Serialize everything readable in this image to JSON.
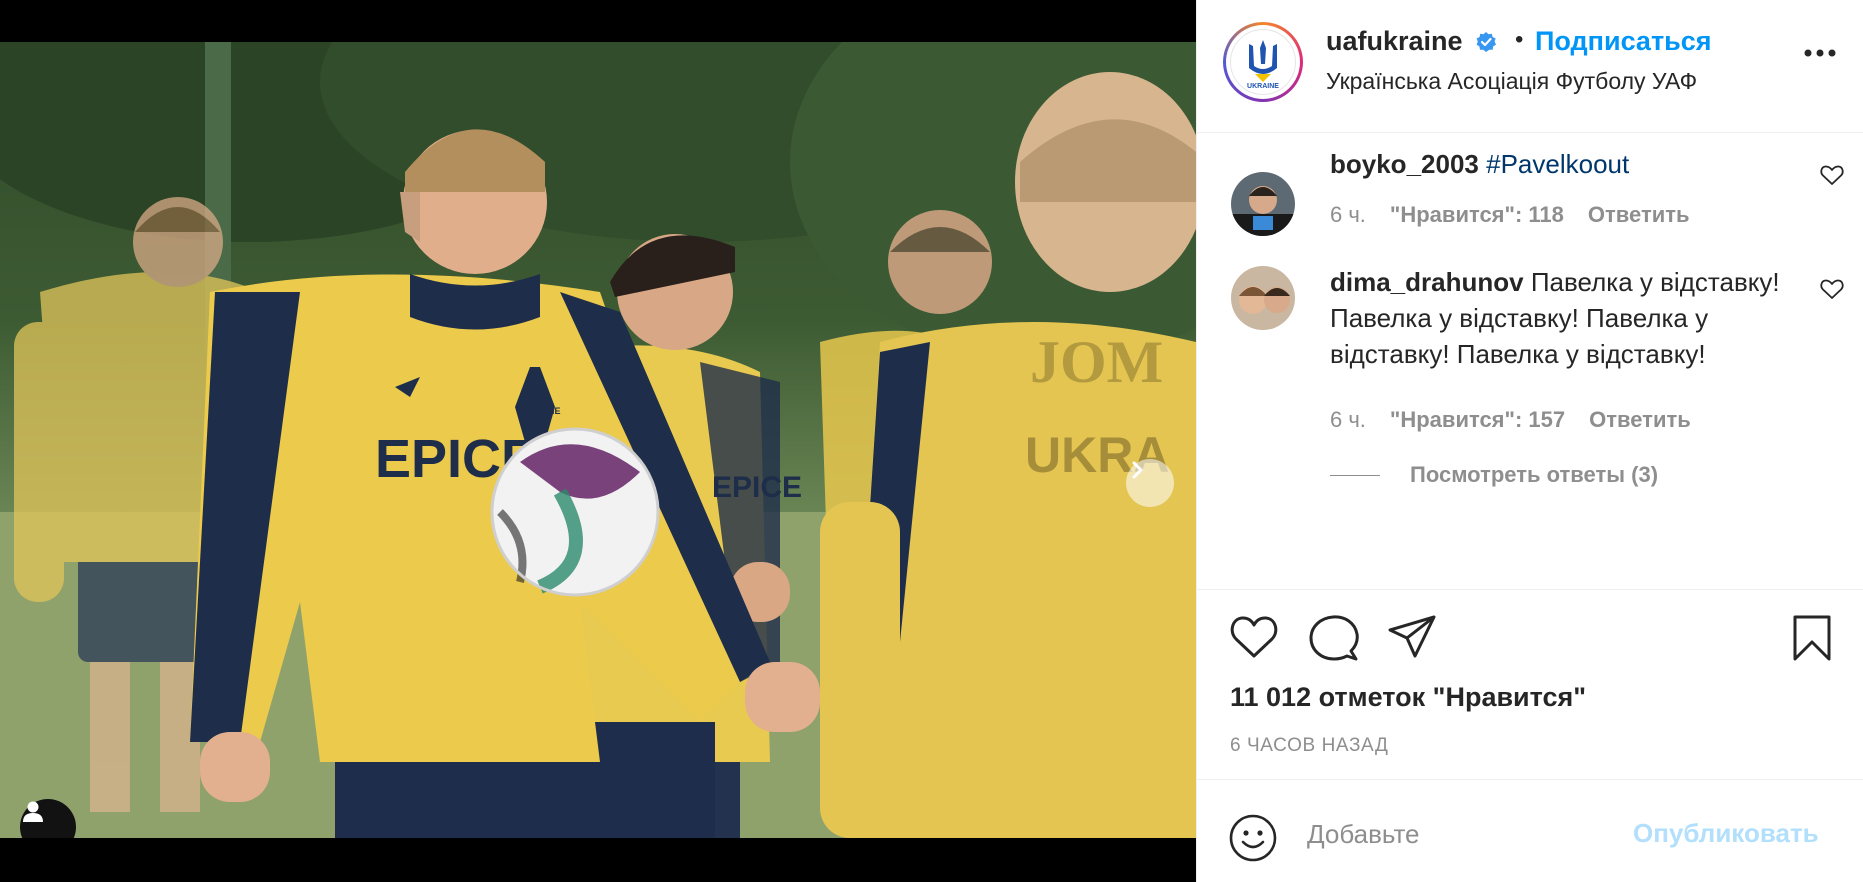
{
  "post": {
    "username": "uafukraine",
    "follow_label": "Подписаться",
    "separator": "•",
    "account_name": "Українська Асоціація Футболу УАФ",
    "avatar_text": "UKRAINE",
    "media": {
      "photo_texts": [
        "EPICE",
        "JOM",
        "UKRA",
        "UKRAINE"
      ],
      "carousel_count": 6,
      "carousel_active_index": 0
    }
  },
  "comments": [
    {
      "username": "boyko_2003",
      "text": "",
      "tag": "#Pavelkoout",
      "time": "6 ч.",
      "likes": "\"Нравится\": 118",
      "reply": "Ответить"
    },
    {
      "username": "dima_drahunov",
      "text": " Павелка у відставку! Павелка у відставку! Павелка у відставку! Павелка у відставку!",
      "tag": "",
      "time": "6 ч.",
      "likes": "\"Нравится\": 157",
      "reply": "Ответить",
      "view_replies": "Посмотреть ответы (3)"
    }
  ],
  "actions": {
    "likes_label": "11 012 отметок \"Нравится\"",
    "time_ago": "6 ЧАСОВ НАЗАД"
  },
  "composer": {
    "placeholder": "Добавьте",
    "publish_label": "Опубликовать"
  },
  "colors": {
    "accent": "#0095f6",
    "publish_disabled": "#b2dffc",
    "jersey_yellow": "#e9c94a",
    "jersey_navy": "#1e2d4a"
  }
}
